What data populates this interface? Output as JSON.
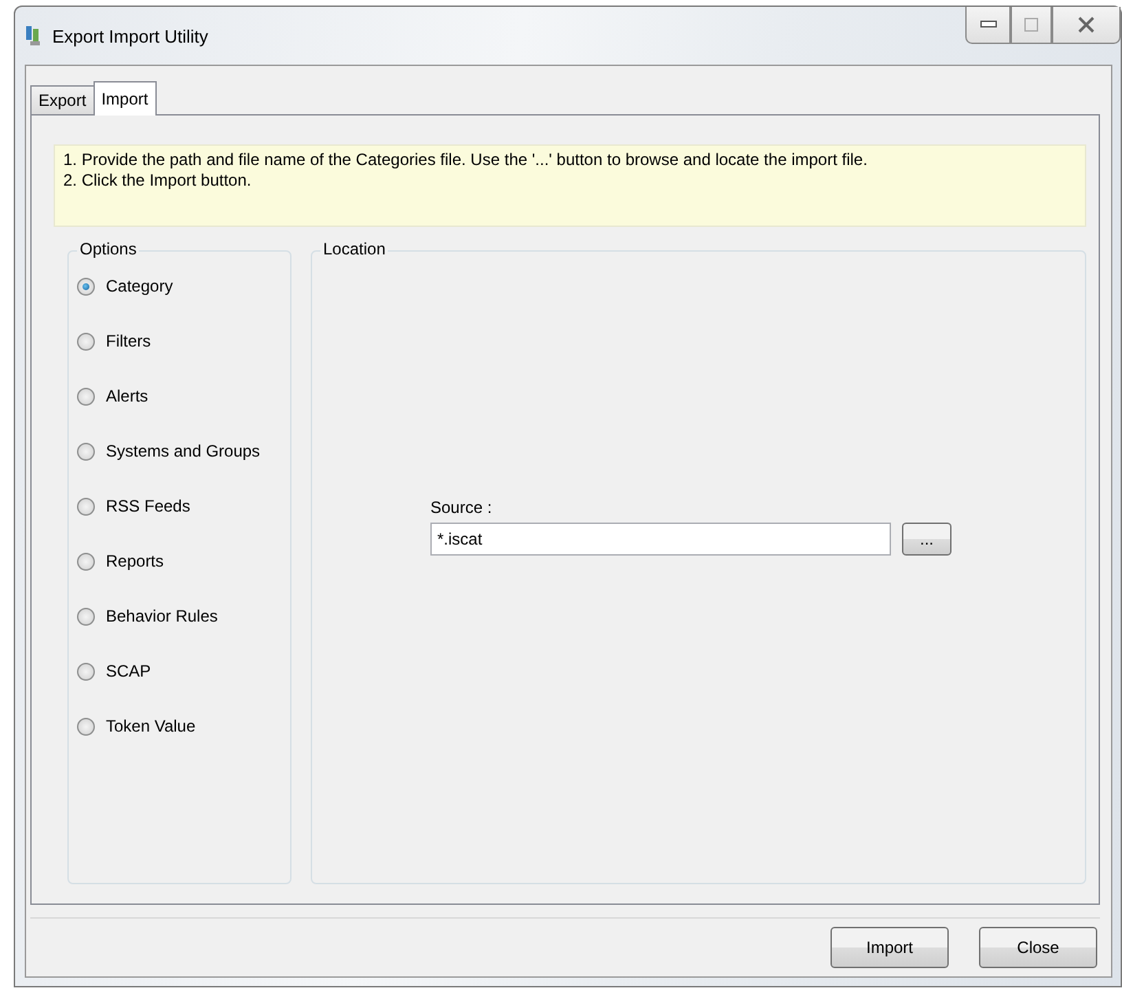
{
  "window": {
    "title": "Export Import Utility"
  },
  "tabs": [
    {
      "label": "Export",
      "selected": false
    },
    {
      "label": "Import",
      "selected": true
    }
  ],
  "instructions": [
    "1. Provide the path and file name of the Categories file. Use the '...' button to browse and locate the import file.",
    "2. Click the Import button."
  ],
  "options": {
    "title": "Options",
    "items": [
      {
        "label": "Category",
        "selected": true
      },
      {
        "label": "Filters",
        "selected": false
      },
      {
        "label": "Alerts",
        "selected": false
      },
      {
        "label": "Systems and Groups",
        "selected": false
      },
      {
        "label": "RSS Feeds",
        "selected": false
      },
      {
        "label": "Reports",
        "selected": false
      },
      {
        "label": "Behavior Rules",
        "selected": false
      },
      {
        "label": "SCAP",
        "selected": false
      },
      {
        "label": "Token Value",
        "selected": false
      }
    ]
  },
  "location": {
    "title": "Location",
    "source_label": "Source :",
    "source_value": "*.iscat",
    "browse_button": "..."
  },
  "buttons": [
    "Import",
    "Close"
  ]
}
